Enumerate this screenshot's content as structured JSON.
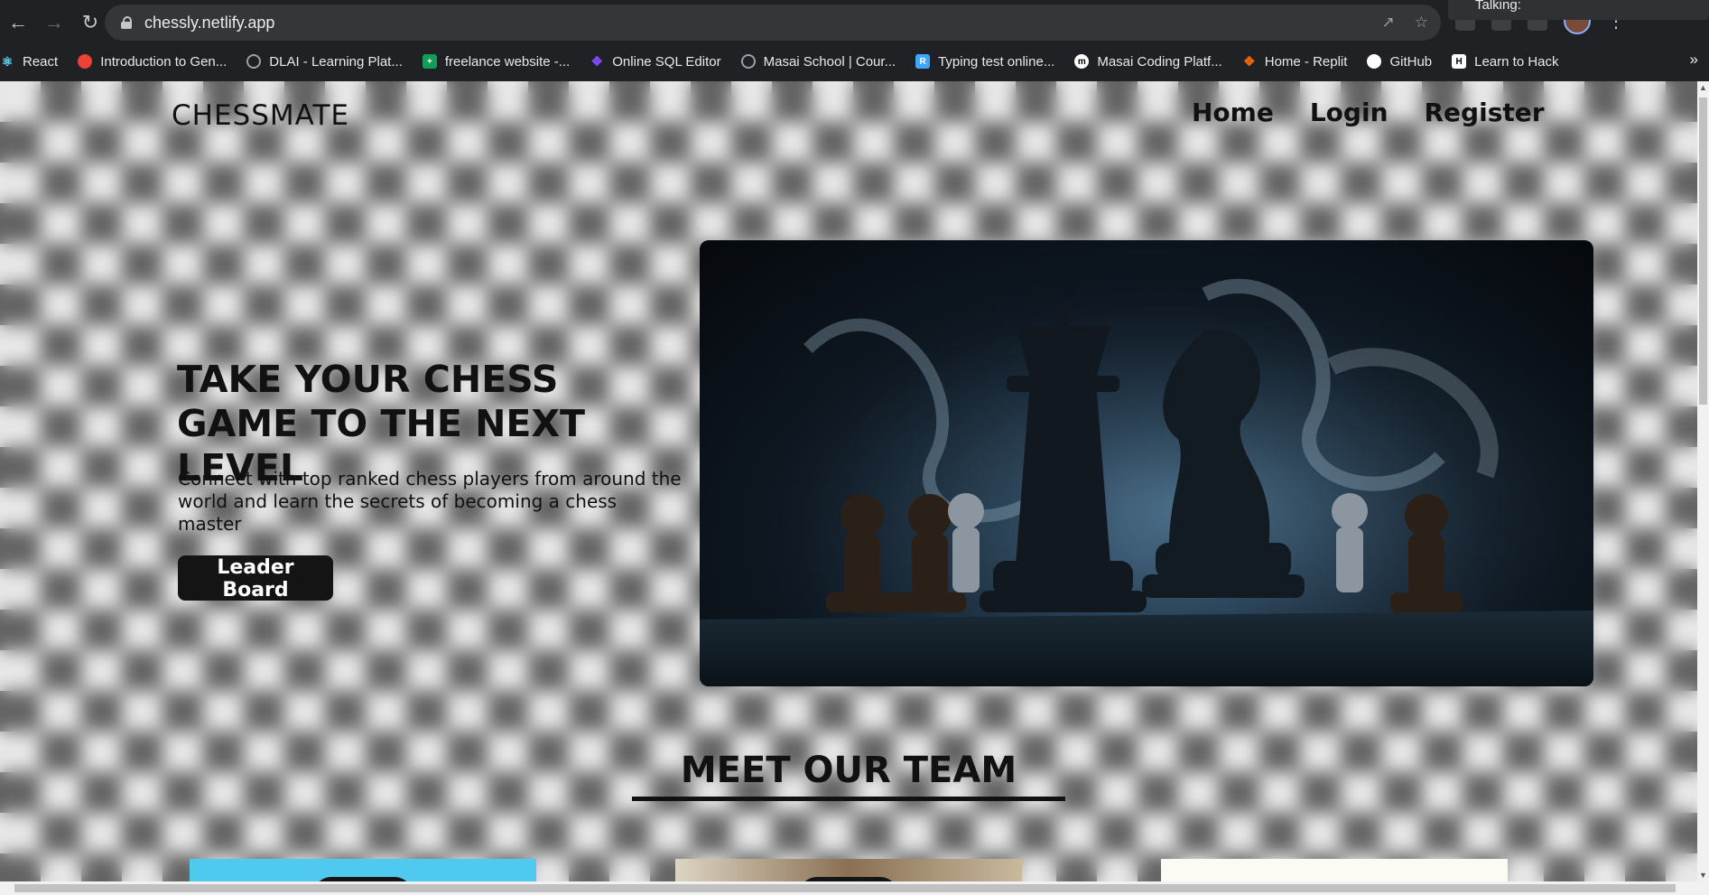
{
  "browser": {
    "url": "chessly.netlify.app",
    "overlay_text": "Talking:",
    "bookmarks": [
      {
        "label": "React",
        "icon": "react-icon",
        "color": "#61dafb"
      },
      {
        "label": "Introduction to Gen...",
        "icon": "google-cloud-icon",
        "color": "#ea4335"
      },
      {
        "label": "DLAI - Learning Plat...",
        "icon": "globe-icon",
        "color": "#9aa0a6"
      },
      {
        "label": "freelance website -...",
        "icon": "sheets-icon",
        "color": "#0f9d58"
      },
      {
        "label": "Online SQL Editor",
        "icon": "sql-editor-icon",
        "color": "#7c4dff"
      },
      {
        "label": "Masai School | Cour...",
        "icon": "globe-icon",
        "color": "#9aa0a6"
      },
      {
        "label": "Typing test online...",
        "icon": "typing-icon",
        "color": "#3ea6ff"
      },
      {
        "label": "Masai Coding Platf...",
        "icon": "masai-icon",
        "color": "#ffffff"
      },
      {
        "label": "Home - Replit",
        "icon": "replit-icon",
        "color": "#f26207"
      },
      {
        "label": "GitHub",
        "icon": "github-icon",
        "color": "#ffffff"
      },
      {
        "label": "Learn to Hack",
        "icon": "hack-icon",
        "color": "#ffffff"
      }
    ],
    "more": "»"
  },
  "site": {
    "brand": "CHESSMATE",
    "nav": [
      "Home",
      "Login",
      "Register"
    ],
    "hero": {
      "title": "TAKE YOUR CHESS GAME TO THE NEXT LEVEL",
      "subtitle": "Connect with top ranked chess players from around the world and learn the secrets of becoming a chess master",
      "button": "Leader Board"
    },
    "team_title": "MEET OUR TEAM"
  }
}
